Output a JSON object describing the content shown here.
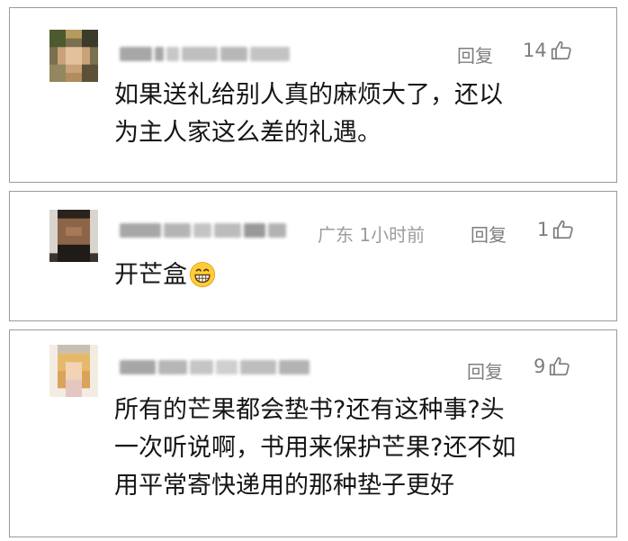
{
  "comments": [
    {
      "location": "",
      "time": "",
      "reply_label": "回复",
      "likes": "14",
      "text_lines": [
        "如果送礼给别人真的麻烦大了，还以",
        "为主人家这么差的礼遇。"
      ]
    },
    {
      "location": "广东",
      "time": "1小时前",
      "reply_label": "回复",
      "likes": "1",
      "text_lines": [
        "开芒盒"
      ],
      "emoji": "grinning-face-emoji"
    },
    {
      "location": "",
      "time": "",
      "reply_label": "回复",
      "likes": "9",
      "text_lines": [
        "所有的芒果都会垫书?还有这种事?头",
        "一次听说啊，书用来保护芒果?还不如",
        "用平常寄快递用的那种垫子更好"
      ]
    }
  ],
  "icons": {
    "like": "thumbs-up-outline-icon",
    "emoji": "grinning-face-emoji"
  },
  "colors": {
    "border": "#9a9a9a",
    "meta_text": "#7d7d7d",
    "body_text": "#151515"
  }
}
